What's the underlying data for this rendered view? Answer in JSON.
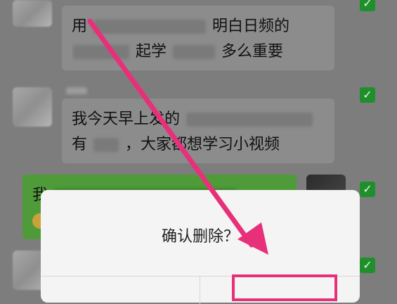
{
  "messages": [
    {
      "side": "left",
      "line1": "用",
      "line1_end": "明白日频的",
      "line2_mid": "起学",
      "line2_end": "多么重要"
    },
    {
      "side": "left",
      "line1": "我今天早上发的",
      "line2_start": "有",
      "line2_end": "，大家都想学习小视频"
    },
    {
      "side": "right",
      "line1": "我"
    }
  ],
  "dialog": {
    "title": "确认删除？",
    "cancel_label": "",
    "confirm_label": ""
  },
  "check_glyph": "✓",
  "icons": [
    "checkbox-checked-icon",
    "annotation-arrow"
  ],
  "colors": {
    "check": "#1f8f2c",
    "arrow": "#e8307a",
    "self_bubble": "#4f9b3a",
    "dialog": "#f4f4f4"
  }
}
